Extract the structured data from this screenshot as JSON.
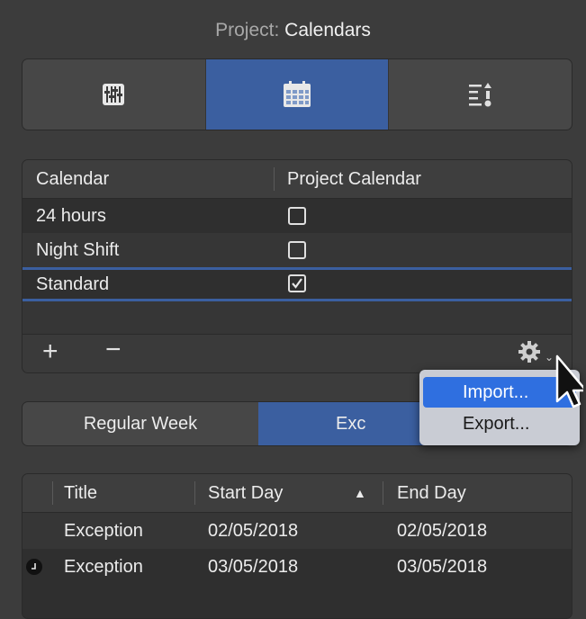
{
  "header": {
    "prefix": "Project:",
    "title": "Calendars"
  },
  "tabs": [
    {
      "icon": "sliders-icon",
      "active": false
    },
    {
      "icon": "calendar-icon",
      "active": true
    },
    {
      "icon": "list-sort-icon",
      "active": false
    }
  ],
  "calendar_table": {
    "columns": [
      "Calendar",
      "Project Calendar"
    ],
    "rows": [
      {
        "name": "24 hours",
        "project_calendar": false
      },
      {
        "name": "Night Shift",
        "project_calendar": false
      },
      {
        "name": "Standard",
        "project_calendar": true,
        "selected": true
      }
    ],
    "footer": {
      "add_label": "+",
      "remove_label": "−",
      "gear_icon": "gear-icon"
    }
  },
  "segments": {
    "regular_week": "Regular Week",
    "exceptions": "Exc"
  },
  "exceptions_table": {
    "columns": [
      "Title",
      "Start Day",
      "End Day"
    ],
    "sort_indicator": "▲",
    "rows": [
      {
        "title": "Exception",
        "start": "02/05/2018",
        "end": "02/05/2018"
      },
      {
        "title": "Exception",
        "start": "03/05/2018",
        "end": "03/05/2018"
      }
    ]
  },
  "menu": {
    "import_label": "Import...",
    "export_label": "Export..."
  },
  "colors": {
    "accent": "#3b5fa0",
    "menu_highlight": "#2f6fe0",
    "background": "#3c3c3c"
  }
}
